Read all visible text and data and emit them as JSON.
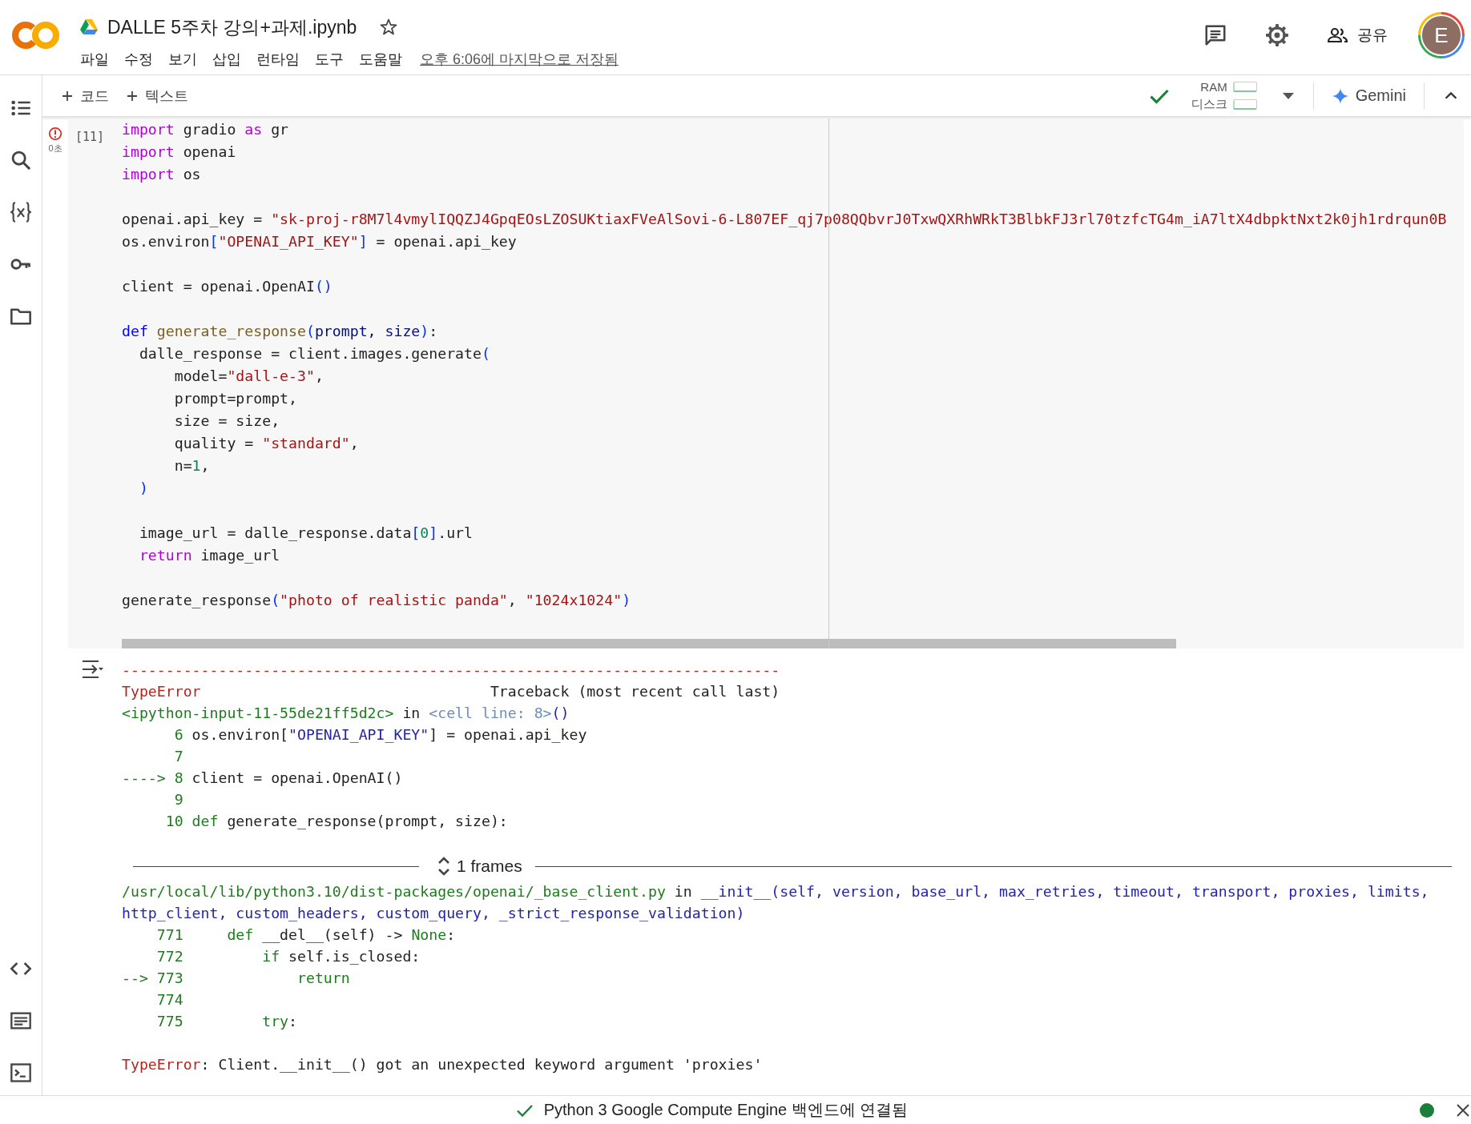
{
  "header": {
    "title": "DALLE 5주차 강의+과제.ipynb",
    "starred": false,
    "menu": [
      "파일",
      "수정",
      "보기",
      "삽입",
      "런타임",
      "도구",
      "도움말"
    ],
    "last_saved": "오후 6:06에 마지막으로 저장됨",
    "share": "공유",
    "avatar": "E"
  },
  "toolbar": {
    "add_buttons": [
      "코드",
      "텍스트"
    ],
    "resources": [
      {
        "label": "RAM",
        "level": 0.05
      },
      {
        "label": "디스크",
        "level": 0.05
      }
    ],
    "gemini": "Gemini"
  },
  "cell": {
    "errored": true,
    "elapsed": "0초",
    "count": "[11]",
    "blocks": [
      [
        [
          {
            "text": "import",
            "kind": "keyword"
          },
          {
            "text": " gradio ",
            "kind": "plain"
          },
          {
            "text": "as",
            "kind": "keyword"
          },
          {
            "text": " gr",
            "kind": "plain"
          }
        ],
        [
          {
            "text": "import",
            "kind": "keyword"
          },
          {
            "text": " openai",
            "kind": "plain"
          }
        ],
        [
          {
            "text": "import",
            "kind": "keyword"
          },
          {
            "text": " os",
            "kind": "plain"
          }
        ]
      ],
      [
        [
          {
            "text": "openai.api_key = ",
            "kind": "plain"
          },
          {
            "text": "\"sk-proj-r8M7l4vmylIQQZJ4GpqEOsLZOSUKtiaxFVeAlSovi-6-L807EF_qj7p08QQbvrJ0TxwQXRhWRkT3BlbkFJ3rl70tzfcTG4m_iA7ltX4dbpktNxt2k0jh1rdrqun0B",
            "kind": "string"
          }
        ],
        [
          {
            "text": "os.environ",
            "kind": "plain"
          },
          {
            "text": "[",
            "kind": "bracket"
          },
          {
            "text": "\"OPENAI_API_KEY\"",
            "kind": "string"
          },
          {
            "text": "]",
            "kind": "bracket"
          },
          {
            "text": " = openai.api_key",
            "kind": "plain"
          }
        ]
      ],
      [
        [
          {
            "text": "client = openai.OpenAI",
            "kind": "plain"
          },
          {
            "text": "()",
            "kind": "bracket"
          }
        ]
      ],
      [
        [
          {
            "text": "def ",
            "kind": "def"
          },
          {
            "text": "generate_response",
            "kind": "func"
          },
          {
            "text": "(",
            "kind": "bracket"
          },
          {
            "text": "prompt, size",
            "kind": "param"
          },
          {
            "text": ")",
            "kind": "bracket"
          },
          {
            "text": ":",
            "kind": "plain"
          }
        ],
        [
          {
            "text": "  dalle_response = client.images.generate",
            "kind": "plain"
          },
          {
            "text": "(",
            "kind": "bracket"
          }
        ],
        [
          {
            "text": "      model=",
            "kind": "plain"
          },
          {
            "text": "\"dall-e-3\"",
            "kind": "string"
          },
          {
            "text": ",",
            "kind": "plain"
          }
        ],
        [
          {
            "text": "      prompt=prompt,",
            "kind": "plain"
          }
        ],
        [
          {
            "text": "      size = size,",
            "kind": "plain"
          }
        ],
        [
          {
            "text": "      quality = ",
            "kind": "plain"
          },
          {
            "text": "\"standard\"",
            "kind": "string"
          },
          {
            "text": ",",
            "kind": "plain"
          }
        ],
        [
          {
            "text": "      n=",
            "kind": "plain"
          },
          {
            "text": "1",
            "kind": "number"
          },
          {
            "text": ",",
            "kind": "plain"
          }
        ],
        [
          {
            "text": "  )",
            "kind": "bracket"
          }
        ]
      ],
      [
        [
          {
            "text": "  image_url = dalle_response.data",
            "kind": "plain"
          },
          {
            "text": "[",
            "kind": "bracket"
          },
          {
            "text": "0",
            "kind": "number"
          },
          {
            "text": "]",
            "kind": "bracket"
          },
          {
            "text": ".url",
            "kind": "plain"
          }
        ],
        [
          {
            "text": "  return",
            "kind": "keyword"
          },
          {
            "text": " image_url",
            "kind": "plain"
          }
        ]
      ],
      [
        [
          {
            "text": "generate_response",
            "kind": "plain"
          },
          {
            "text": "(",
            "kind": "bracket"
          },
          {
            "text": "\"photo of realistic panda\"",
            "kind": "string"
          },
          {
            "text": ", ",
            "kind": "plain"
          },
          {
            "text": "\"1024x1024\"",
            "kind": "string"
          },
          {
            "text": ")",
            "kind": "bracket"
          }
        ]
      ]
    ]
  },
  "output": {
    "blocks_before": [
      [
        [
          {
            "text": "---------------------------------------------------------------------------",
            "kind": "error"
          }
        ],
        [
          {
            "text": "TypeError",
            "kind": "error"
          },
          {
            "text": "                                 Traceback (most recent call last)",
            "kind": "plain"
          }
        ],
        [
          {
            "text": "<ipython-input-11-55de21ff5d2c>",
            "kind": "green"
          },
          {
            "text": " in ",
            "kind": "plain"
          },
          {
            "text": "<cell line: 8>",
            "kind": "cellref"
          },
          {
            "text": "()",
            "kind": "link"
          }
        ],
        [
          {
            "text": "      6 ",
            "kind": "green"
          },
          {
            "text": "os.environ[",
            "kind": "plain"
          },
          {
            "text": "\"OPENAI_API_KEY\"",
            "kind": "link"
          },
          {
            "text": "] = openai.api_key",
            "kind": "plain"
          }
        ],
        [
          {
            "text": "      7",
            "kind": "green"
          }
        ],
        [
          {
            "text": "----> 8 ",
            "kind": "green"
          },
          {
            "text": "client = openai.OpenAI()",
            "kind": "plain"
          }
        ],
        [
          {
            "text": "      9",
            "kind": "green"
          }
        ],
        [
          {
            "text": "     10 ",
            "kind": "green"
          },
          {
            "text": "def",
            "kind": "green"
          },
          {
            "text": " generate_response(prompt, size):",
            "kind": "plain"
          }
        ]
      ]
    ],
    "frames": "1 frames",
    "blocks_after": [
      [
        [
          {
            "text": "/usr/local/lib/python3.10/dist-packages/openai/_base_client.py",
            "kind": "green"
          },
          {
            "text": " in ",
            "kind": "plain"
          },
          {
            "text": "__init__(self, version, base_url, max_retries, timeout, transport, proxies, limits,",
            "kind": "link"
          }
        ],
        [
          {
            "text": "http_client, custom_headers, custom_query, _strict_response_validation)",
            "kind": "link"
          }
        ],
        [
          {
            "text": "    771     ",
            "kind": "green"
          },
          {
            "text": "def",
            "kind": "green"
          },
          {
            "text": " __del__(self) -> ",
            "kind": "plain"
          },
          {
            "text": "None",
            "kind": "green"
          },
          {
            "text": ":",
            "kind": "plain"
          }
        ],
        [
          {
            "text": "    772         ",
            "kind": "green"
          },
          {
            "text": "if",
            "kind": "green"
          },
          {
            "text": " self.is_closed:",
            "kind": "plain"
          }
        ],
        [
          {
            "text": "--> 773             ",
            "kind": "green"
          },
          {
            "text": "return",
            "kind": "green"
          }
        ],
        [
          {
            "text": "    774",
            "kind": "green"
          }
        ],
        [
          {
            "text": "    775         ",
            "kind": "green"
          },
          {
            "text": "try",
            "kind": "green"
          },
          {
            "text": ":",
            "kind": "plain"
          }
        ]
      ],
      [
        [
          {
            "text": "TypeError",
            "kind": "error"
          },
          {
            "text": ": Client.__init__() got an unexpected keyword argument 'proxies'",
            "kind": "plain"
          }
        ]
      ]
    ]
  },
  "status_bar": {
    "message": "Python 3 Google Compute Engine 백엔드에 연결됨"
  }
}
